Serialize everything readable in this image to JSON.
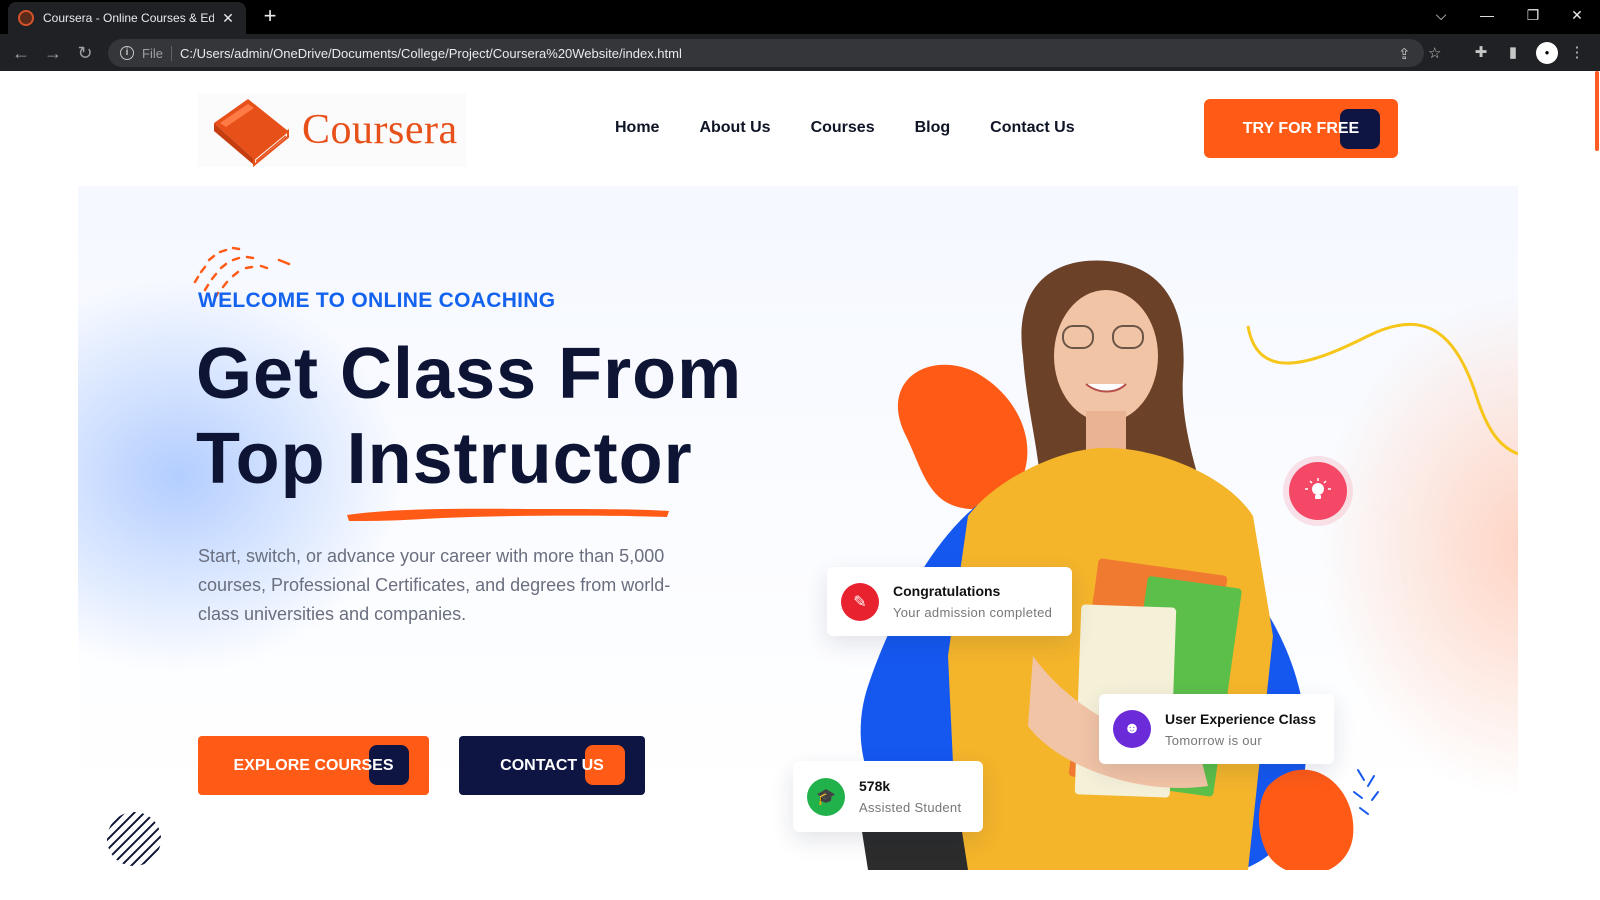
{
  "browser": {
    "tab_title": "Coursera - Online Courses & Edu",
    "file_label": "File",
    "url": "C:/Users/admin/OneDrive/Documents/College/Project/Coursera%20Website/index.html",
    "controls": {
      "tabs_menu": "⌵",
      "minimize": "—",
      "restore": "❐",
      "close": "✕"
    }
  },
  "header": {
    "logo_text": "Coursera",
    "nav": [
      "Home",
      "About Us",
      "Courses",
      "Blog",
      "Contact Us"
    ],
    "cta_label": "TRY FOR FREE"
  },
  "hero": {
    "tagline": "WELCOME TO ONLINE COACHING",
    "title_line1": "Get Class From",
    "title_line2": "Top Instructor",
    "description": "Start, switch, or advance your career with more than 5,000 courses, Professional Certificates, and degrees from world-class universities and companies.",
    "explore_label": "EXPLORE COURSES",
    "contact_label": "CONTACT US"
  },
  "cards": {
    "congrats": {
      "title": "Congratulations",
      "subtitle": "Your admission completed",
      "icon": "edit-icon"
    },
    "class": {
      "title": "User Experience Class",
      "subtitle": "Tomorrow is our",
      "icon": "user-group-icon"
    },
    "students": {
      "title": "578k",
      "subtitle": "Assisted Student",
      "icon": "graduation-cap-icon"
    }
  },
  "colors": {
    "accent_orange": "#ff5b17",
    "navy": "#0e1542",
    "blue": "#1463ee",
    "pink": "#f44866",
    "green": "#22b24c",
    "purple": "#6c2bd9",
    "red": "#e8222e"
  }
}
